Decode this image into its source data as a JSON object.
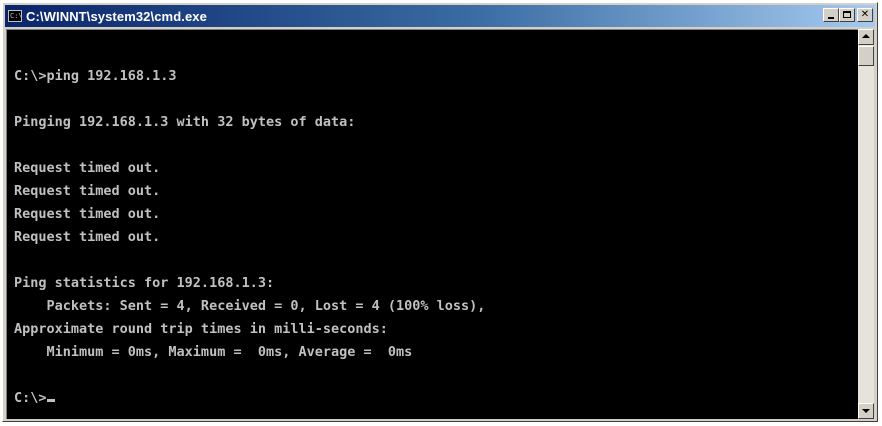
{
  "window": {
    "title": "C:\\WINNT\\system32\\cmd.exe",
    "icon_label": "C:\\"
  },
  "controls": {
    "close_glyph": "✕"
  },
  "console": {
    "lines": [
      "",
      "C:\\>ping 192.168.1.3",
      "",
      "Pinging 192.168.1.3 with 32 bytes of data:",
      "",
      "Request timed out.",
      "Request timed out.",
      "Request timed out.",
      "Request timed out.",
      "",
      "Ping statistics for 192.168.1.3:",
      "    Packets: Sent = 4, Received = 0, Lost = 4 (100% loss),",
      "Approximate round trip times in milli-seconds:",
      "    Minimum = 0ms, Maximum =  0ms, Average =  0ms",
      "",
      "C:\\>"
    ]
  },
  "colors": {
    "titlebar_start": "#0a246a",
    "titlebar_end": "#a6caf0",
    "console_bg": "#000000",
    "console_text": "#c0c0c0"
  }
}
